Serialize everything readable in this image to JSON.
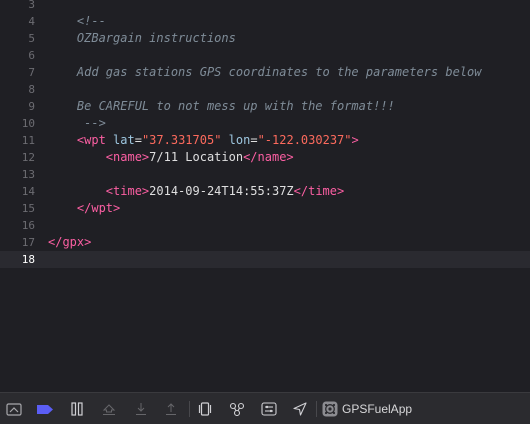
{
  "editor": {
    "lines": [
      {
        "num": "3",
        "tokens": []
      },
      {
        "num": "4",
        "tokens": [
          {
            "t": "    <!--",
            "c": "comment"
          }
        ]
      },
      {
        "num": "5",
        "tokens": [
          {
            "t": "    OZBargain instructions",
            "c": "comment"
          }
        ]
      },
      {
        "num": "6",
        "tokens": []
      },
      {
        "num": "7",
        "tokens": [
          {
            "t": "    Add gas stations GPS coordinates to the parameters below",
            "c": "comment"
          }
        ]
      },
      {
        "num": "8",
        "tokens": []
      },
      {
        "num": "9",
        "tokens": [
          {
            "t": "    Be CAREFUL to not mess up with the format!!!",
            "c": "comment"
          }
        ]
      },
      {
        "num": "10",
        "tokens": [
          {
            "t": "     -->",
            "c": "comment"
          }
        ]
      },
      {
        "num": "11",
        "tokens": [
          {
            "t": "    ",
            "c": "plain"
          },
          {
            "t": "<wpt",
            "c": "tag"
          },
          {
            "t": " lat",
            "c": "attr"
          },
          {
            "t": "=",
            "c": "plain"
          },
          {
            "t": "\"37.331705\"",
            "c": "str"
          },
          {
            "t": " lon",
            "c": "attr"
          },
          {
            "t": "=",
            "c": "plain"
          },
          {
            "t": "\"-122.030237\"",
            "c": "str"
          },
          {
            "t": ">",
            "c": "tag"
          }
        ]
      },
      {
        "num": "12",
        "tokens": [
          {
            "t": "        ",
            "c": "plain"
          },
          {
            "t": "<name>",
            "c": "tag"
          },
          {
            "t": "7/11 Location",
            "c": "plain"
          },
          {
            "t": "</name>",
            "c": "tag"
          }
        ]
      },
      {
        "num": "13",
        "tokens": []
      },
      {
        "num": "14",
        "tokens": [
          {
            "t": "        ",
            "c": "plain"
          },
          {
            "t": "<time>",
            "c": "tag"
          },
          {
            "t": "2014-09-24T14:55:37Z",
            "c": "plain"
          },
          {
            "t": "</time>",
            "c": "tag"
          }
        ]
      },
      {
        "num": "15",
        "tokens": [
          {
            "t": "    ",
            "c": "plain"
          },
          {
            "t": "</wpt>",
            "c": "tag"
          }
        ]
      },
      {
        "num": "16",
        "tokens": []
      },
      {
        "num": "17",
        "tokens": [
          {
            "t": "</gpx>",
            "c": "tag"
          }
        ]
      },
      {
        "num": "18",
        "tokens": [],
        "current": true
      }
    ]
  },
  "debug_bar": {
    "buttons": [
      {
        "name": "hide-debug-area-icon"
      },
      {
        "name": "breakpoints-toggle-icon",
        "active": true,
        "color": "#5b5ef5"
      },
      {
        "name": "pause-icon"
      },
      {
        "name": "step-over-icon"
      },
      {
        "name": "step-into-icon"
      },
      {
        "name": "step-out-icon"
      },
      {
        "name": "view-hierarchy-icon"
      },
      {
        "name": "memory-graph-icon"
      },
      {
        "name": "environment-overrides-icon"
      },
      {
        "name": "simulate-location-icon"
      }
    ],
    "scheme": {
      "icon": "app-target-icon",
      "label": "GPSFuelApp"
    }
  },
  "colors": {
    "background": "#1f1f24",
    "comment": "#7f8c98",
    "tag": "#fc5fa3",
    "attribute": "#9ec7e0",
    "string": "#fc6a5d",
    "plain": "#dfdfe0",
    "accent": "#5b5ef5"
  }
}
